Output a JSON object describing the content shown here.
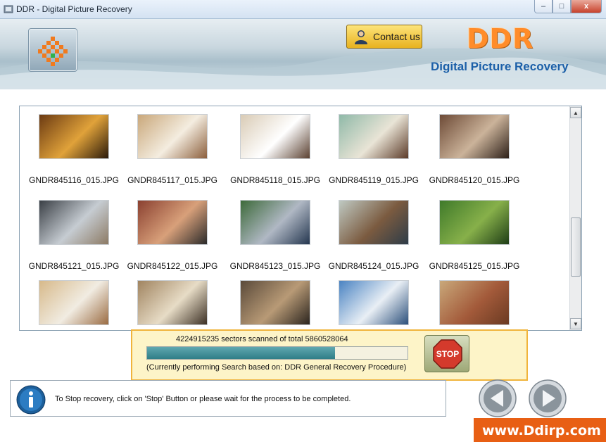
{
  "window": {
    "title": "DDR - Digital Picture Recovery",
    "minimize": "–",
    "maximize": "□",
    "close": "x"
  },
  "header": {
    "contact_label": "Contact us",
    "brand": "DDR",
    "subtitle": "Digital Picture Recovery"
  },
  "gallery": {
    "items": [
      {
        "file": "GNDR845116_015.JPG",
        "palette": [
          "#6b3a12",
          "#e0a23a",
          "#2b1a0a"
        ]
      },
      {
        "file": "GNDR845117_015.JPG",
        "palette": [
          "#c9a77a",
          "#f4ede0",
          "#8b5e3c"
        ]
      },
      {
        "file": "GNDR845118_015.JPG",
        "palette": [
          "#d9cbb5",
          "#ffffff",
          "#5a4030"
        ]
      },
      {
        "file": "GNDR845119_015.JPG",
        "palette": [
          "#8fb9a8",
          "#e9e4d6",
          "#5b3a28"
        ]
      },
      {
        "file": "GNDR845120_015.JPG",
        "palette": [
          "#6d4a36",
          "#cbb39a",
          "#2c1f18"
        ]
      },
      {
        "file": "GNDR845121_015.JPG",
        "palette": [
          "#3a3f45",
          "#c6ccd2",
          "#8c7a64"
        ]
      },
      {
        "file": "GNDR845122_015.JPG",
        "palette": [
          "#8a4030",
          "#d8a07a",
          "#2a2a2a"
        ]
      },
      {
        "file": "GNDR845123_015.JPG",
        "palette": [
          "#3d6a3a",
          "#b0b8c4",
          "#24364f"
        ]
      },
      {
        "file": "GNDR845124_015.JPG",
        "palette": [
          "#bfc9c2",
          "#7b5b40",
          "#2d3c48"
        ]
      },
      {
        "file": "GNDR845125_015.JPG",
        "palette": [
          "#3f7a2a",
          "#87b04a",
          "#1e3d16"
        ]
      },
      {
        "file": "",
        "palette": [
          "#d7b98a",
          "#f1ece2",
          "#9a6b42"
        ]
      },
      {
        "file": "",
        "palette": [
          "#a08460",
          "#e7dcc6",
          "#3b2f24"
        ]
      },
      {
        "file": "",
        "palette": [
          "#5a4a3a",
          "#b89a76",
          "#2a241e"
        ]
      },
      {
        "file": "",
        "palette": [
          "#4a83c2",
          "#e9eff5",
          "#2b4f7a"
        ]
      },
      {
        "file": "",
        "palette": [
          "#c9a87a",
          "#a35a3a",
          "#6a3a22"
        ]
      }
    ]
  },
  "progress": {
    "scan_text": "4224915235 sectors scanned of total 5860528064",
    "fraction": 0.7209,
    "procedure_text": "(Currently performing Search based on:  DDR General Recovery Procedure)",
    "stop_label": "STOP"
  },
  "footer": {
    "info_text": "To Stop recovery, click on 'Stop' Button or please wait for the process to be completed."
  },
  "watermark": "www.Ddirp.com"
}
